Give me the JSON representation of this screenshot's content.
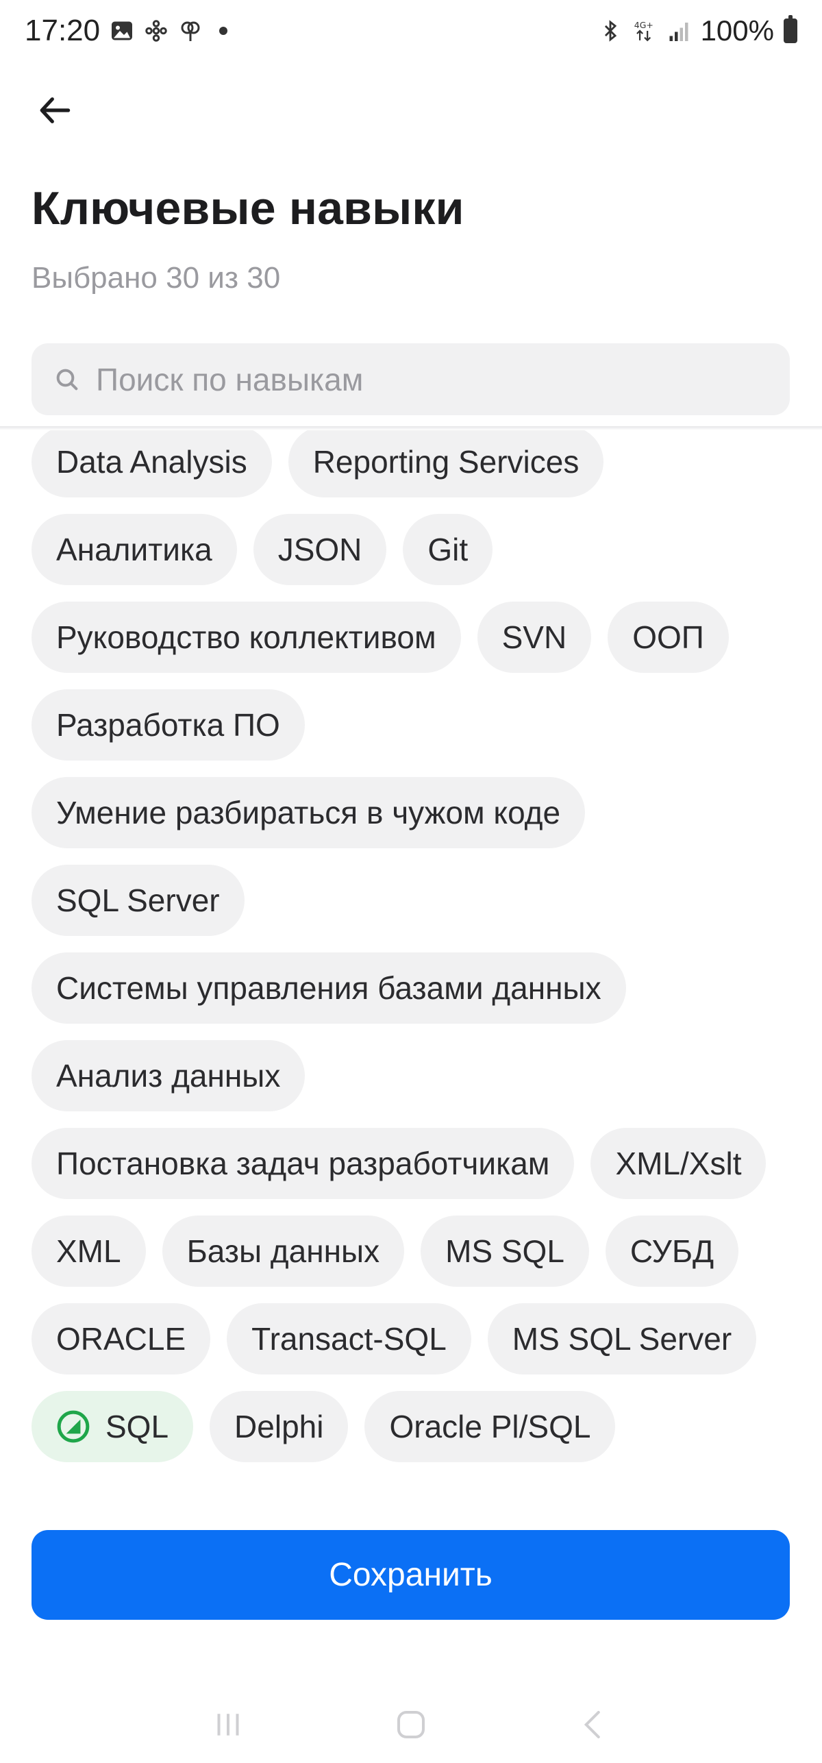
{
  "status_bar": {
    "time": "17:20",
    "battery": "100%",
    "icons": [
      "image-icon",
      "flower-icon",
      "tree-icon",
      "bluetooth-icon",
      "network-4g-icon",
      "signal-icon",
      "battery-icon"
    ]
  },
  "header": {
    "title": "Ключевые навыки",
    "subtitle": "Выбрано 30 из 30"
  },
  "search": {
    "placeholder": "Поиск по навыкам",
    "value": ""
  },
  "skills": [
    {
      "label": "Data Analysis",
      "selected": false
    },
    {
      "label": "Reporting Services",
      "selected": false
    },
    {
      "label": "Аналитика",
      "selected": false
    },
    {
      "label": "JSON",
      "selected": false
    },
    {
      "label": "Git",
      "selected": false
    },
    {
      "label": "Руководство коллективом",
      "selected": false
    },
    {
      "label": "SVN",
      "selected": false
    },
    {
      "label": "ООП",
      "selected": false
    },
    {
      "label": "Разработка ПО",
      "selected": false
    },
    {
      "label": "Умение разбираться в чужом коде",
      "selected": false
    },
    {
      "label": "SQL Server",
      "selected": false
    },
    {
      "label": "Системы управления базами данных",
      "selected": false
    },
    {
      "label": "Анализ данных",
      "selected": false
    },
    {
      "label": "Постановка задач разработчикам",
      "selected": false
    },
    {
      "label": "XML/Xslt",
      "selected": false
    },
    {
      "label": "XML",
      "selected": false
    },
    {
      "label": "Базы данных",
      "selected": false
    },
    {
      "label": "MS SQL",
      "selected": false
    },
    {
      "label": "СУБД",
      "selected": false
    },
    {
      "label": "ORACLE",
      "selected": false
    },
    {
      "label": "Transact-SQL",
      "selected": false
    },
    {
      "label": "MS SQL Server",
      "selected": false
    },
    {
      "label": "SQL",
      "selected": true
    },
    {
      "label": "Delphi",
      "selected": false
    },
    {
      "label": "Oracle Pl/SQL",
      "selected": false
    }
  ],
  "actions": {
    "save_label": "Сохранить"
  },
  "colors": {
    "accent": "#0b70f5",
    "chip_bg": "#f1f1f2",
    "chip_selected_bg": "#e7f5ea",
    "check_green": "#1fa64a"
  }
}
